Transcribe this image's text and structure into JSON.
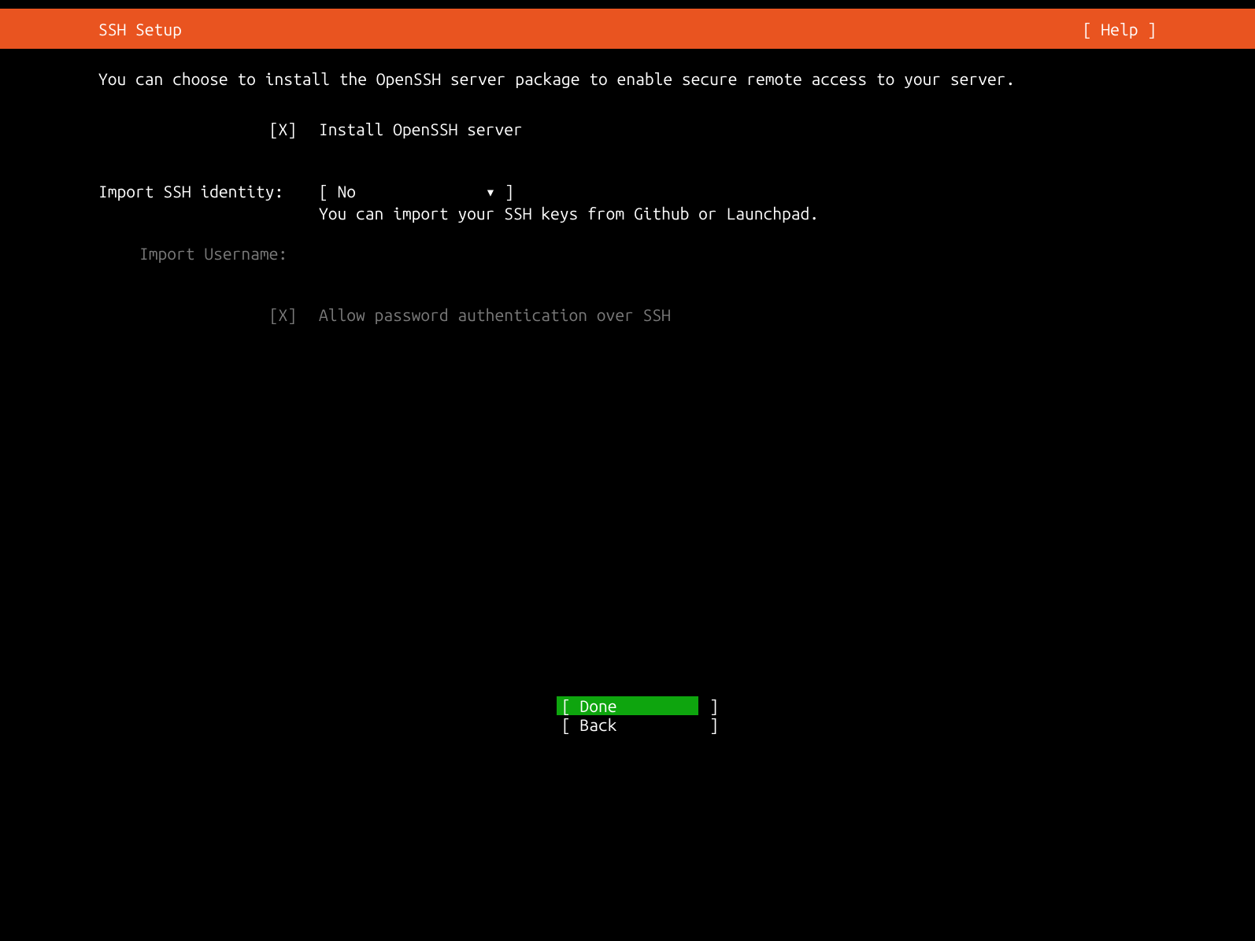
{
  "header": {
    "title": "SSH Setup",
    "help": "[ Help ]"
  },
  "description": "You can choose to install the OpenSSH server package to enable secure remote access to your server.",
  "install_openssh": {
    "checkbox": "[X]",
    "label": "Install OpenSSH server"
  },
  "import_identity": {
    "label": "Import SSH identity:",
    "dropdown": "[ No              ▾ ]",
    "hint": "You can import your SSH keys from Github or Launchpad."
  },
  "import_username": {
    "label": "Import Username:"
  },
  "allow_password": {
    "checkbox": "[X]",
    "label": "Allow password authentication over SSH"
  },
  "buttons": {
    "done": "[ Done          ]",
    "back": "[ Back          ]"
  }
}
